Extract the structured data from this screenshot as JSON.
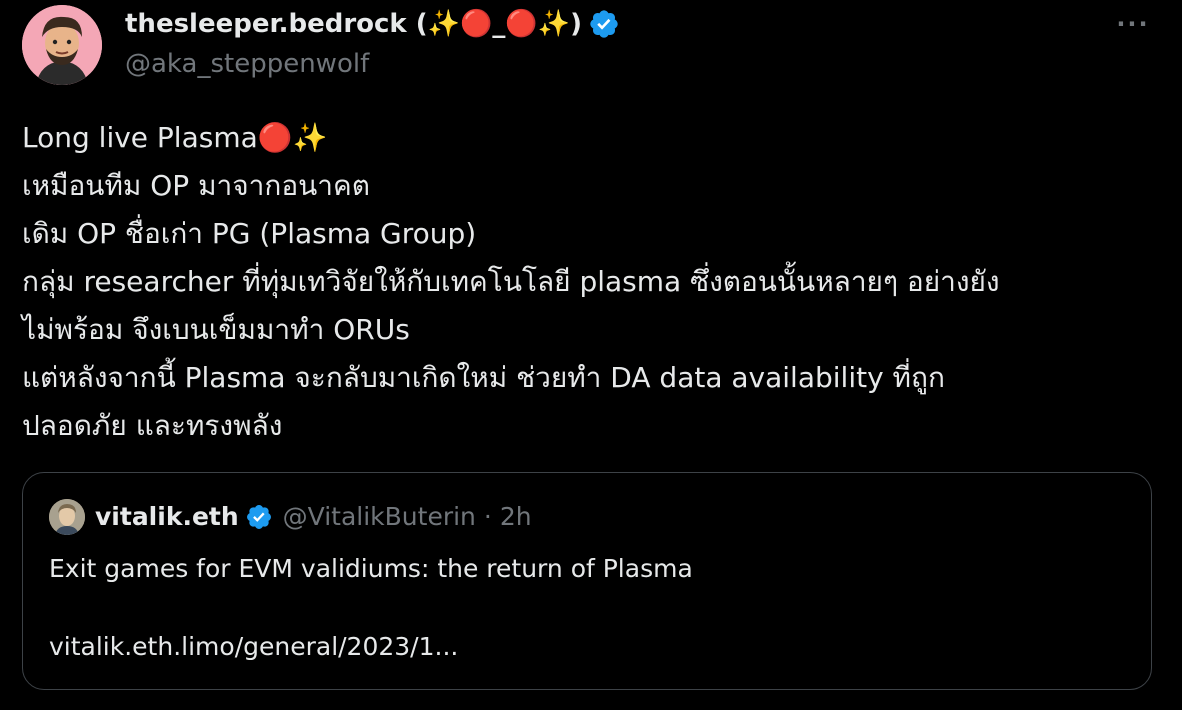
{
  "author": {
    "display_name": "thesleeper.bedrock (✨🔴_🔴✨)",
    "handle": "@aka_steppenwolf"
  },
  "menu": {
    "more_icon": "more-options-icon",
    "more_label": "···"
  },
  "tweet": {
    "lines": [
      "Long live Plasma🔴✨",
      "เหมือนทีม OP มาจากอนาคต",
      "เดิม OP ชื่อเก่า PG (Plasma Group)",
      "กลุ่ม researcher ที่ทุ่มเทวิจัยให้กับเทคโนโลยี plasma ซึ่งตอนนั้นหลายๆ อย่างยัง",
      "ไม่พร้อม จึงเบนเข็มมาทำ ORUs",
      "แต่หลังจากนี้ Plasma จะกลับมาเกิดใหม่ ช่วยทำ DA data availability ที่ถูก",
      "ปลอดภัย และทรงพลัง"
    ]
  },
  "quoted": {
    "name": "vitalik.eth",
    "handle": "@VitalikButerin",
    "separator": "·",
    "time": "2h",
    "text": "Exit games for EVM validiums: the return of Plasma",
    "link": "vitalik.eth.limo/general/2023/1..."
  },
  "colors": {
    "background": "#000000",
    "text": "#e7e9ea",
    "secondary": "#71767b",
    "verified": "#1d9bf0",
    "border": "#3d4247"
  }
}
